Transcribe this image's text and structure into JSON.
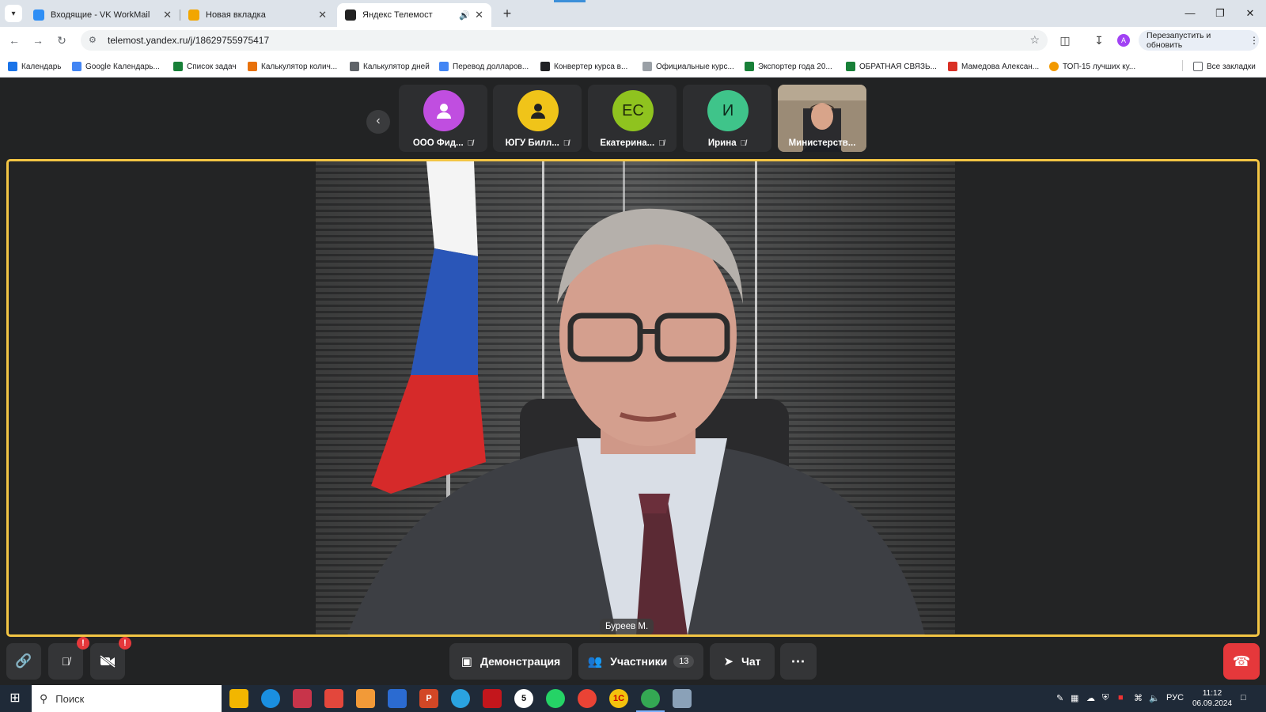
{
  "browser": {
    "tabs": [
      {
        "title": "Входящие - VK WorkMail",
        "favicon_color": "#2e8ef5",
        "active": false
      },
      {
        "title": "Новая вкладка",
        "favicon_color": "#f2a600",
        "active": false
      },
      {
        "title": "Яндекс Телемост",
        "favicon_color": "#222222",
        "active": true
      }
    ],
    "url": "telemost.yandex.ru/j/18629755975417",
    "restart_label": "Перезапустить и обновить",
    "profile_initial": "A",
    "bookmarks": [
      {
        "label": "Календарь",
        "color": "#1a73e8"
      },
      {
        "label": "Google Календарь...",
        "color": "#4285f4"
      },
      {
        "label": "Список задач",
        "color": "#188038"
      },
      {
        "label": "Калькулятор колич...",
        "color": "#e8710a"
      },
      {
        "label": "Калькулятор дней",
        "color": "#5f6368"
      },
      {
        "label": "Перевод долларов...",
        "color": "#4285f4"
      },
      {
        "label": "Конвертер курса в...",
        "color": "#202124"
      },
      {
        "label": "Официальные курс...",
        "color": "#9aa0a6"
      },
      {
        "label": "Экспортер года 20...",
        "color": "#188038"
      },
      {
        "label": "ОБРАТНАЯ СВЯЗЬ...",
        "color": "#188038"
      },
      {
        "label": "Мамедова Алексан...",
        "color": "#d93025"
      },
      {
        "label": "ТОП-15 лучших ку...",
        "color": "#f29900"
      }
    ],
    "all_bookmarks_label": "Все закладки"
  },
  "call": {
    "participants_strip": [
      {
        "name": "ООО Фид...",
        "initials": "",
        "color": "#c04ee0",
        "muted": true
      },
      {
        "name": "ЮГУ Билл...",
        "initials": "",
        "color": "#f0c419",
        "muted": true
      },
      {
        "name": "Екатерина...",
        "initials": "ЕС",
        "color": "#8fc31f",
        "muted": true
      },
      {
        "name": "Ирина",
        "initials": "И",
        "color": "#3fc48a",
        "muted": true
      },
      {
        "name": "Министерств...",
        "initials": "",
        "color": "#8a7a68",
        "muted": false
      }
    ],
    "speaker_name": "Буреев М.",
    "controls": {
      "demo_label": "Демонстрация",
      "participants_label": "Участники",
      "participants_count": "13",
      "chat_label": "Чат",
      "mic_badge": "!",
      "cam_badge": "!"
    },
    "accent_color": "#f3c544"
  },
  "taskbar": {
    "search_placeholder": "Поиск",
    "language": "РУС",
    "time": "11:12",
    "date": "06.09.2024"
  }
}
